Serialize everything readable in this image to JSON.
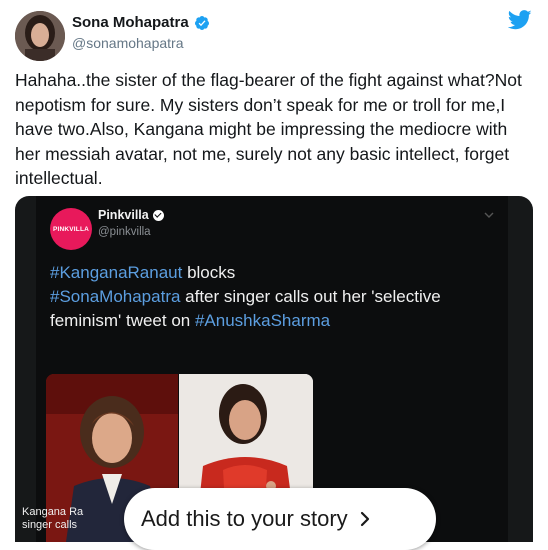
{
  "tweet": {
    "author_name": "Sona Mohapatra",
    "author_handle": "@sonamohapatra",
    "text": "Hahaha..the sister of the flag-bearer of the fight against what?Not nepotism for sure. My sisters don’t speak for me or troll for me,I have two.Also, Kangana might be impressing the mediocre with her messiah avatar, not me, surely not any basic intellect, forget intellectual."
  },
  "embedded_post": {
    "account_name": "Pinkvilla",
    "account_handle": "@pinkvilla",
    "logo_text": "PINKVILLA",
    "text_parts": [
      {
        "text": "#KanganaRanaut",
        "hashtag": true
      },
      {
        "text": " blocks ",
        "hashtag": false
      },
      {
        "text": "#SonaMohapatra",
        "hashtag": true
      },
      {
        "text": " after singer calls out her 'selective feminism' tweet on ",
        "hashtag": false
      },
      {
        "text": "#AnushkaSharma",
        "hashtag": true
      }
    ],
    "caption_line1": "Kangana Ra",
    "caption_line2": "singer calls"
  },
  "story_button": {
    "label": "Add this to your story"
  },
  "icons": {
    "twitter": "twitter-bird-icon",
    "verified": "verified-badge-icon",
    "more": "more-icon",
    "chevron": "chevron-right-icon"
  },
  "colors": {
    "twitter_blue": "#1da1f2",
    "pinkvilla_pink": "#e8195b",
    "hashtag_blue": "#5c9ee0"
  }
}
